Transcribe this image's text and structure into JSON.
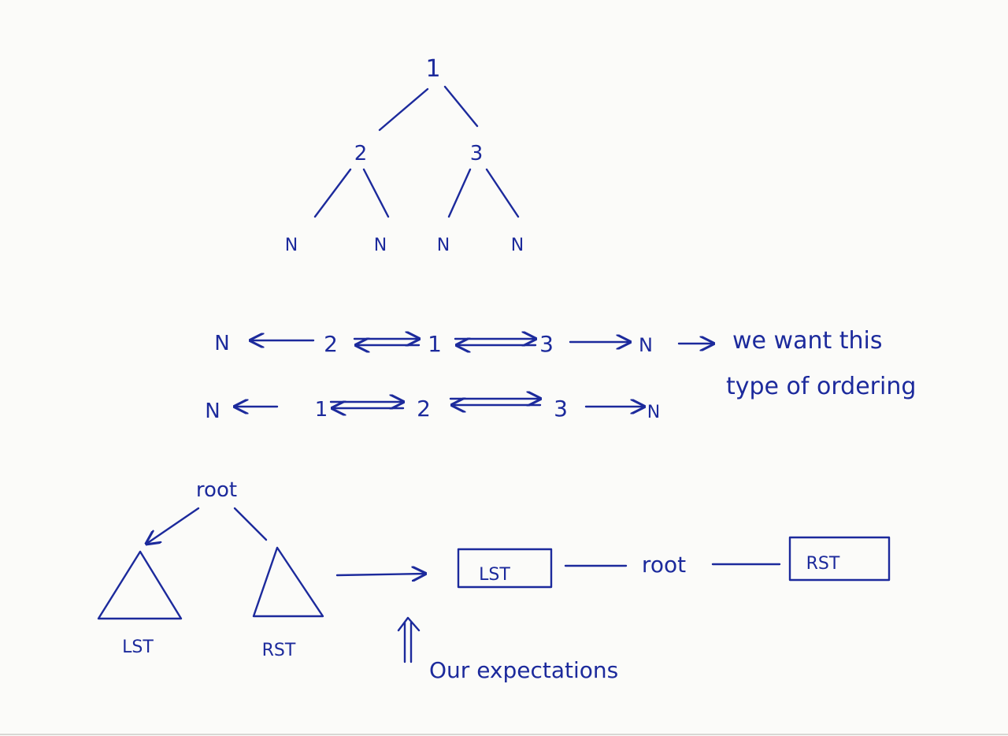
{
  "tree": {
    "root": "1",
    "left": "2",
    "right": "3",
    "leaves": [
      "N",
      "N",
      "N",
      "N"
    ]
  },
  "row1": {
    "items": [
      "N",
      "2",
      "1",
      "3",
      "N"
    ]
  },
  "row2": {
    "items": [
      "N",
      "1",
      "2",
      "3",
      "N"
    ]
  },
  "note": {
    "line1": "we want this",
    "line2": "type of ordering"
  },
  "bottom": {
    "root_label": "root",
    "left_subtree": "LST",
    "right_subtree": "RST",
    "box_left": "LST",
    "box_middle": "root",
    "box_right": "RST",
    "caption": "Our expectations"
  },
  "colors": {
    "ink": "#1c2a9c",
    "paper": "#fbfbf9"
  }
}
